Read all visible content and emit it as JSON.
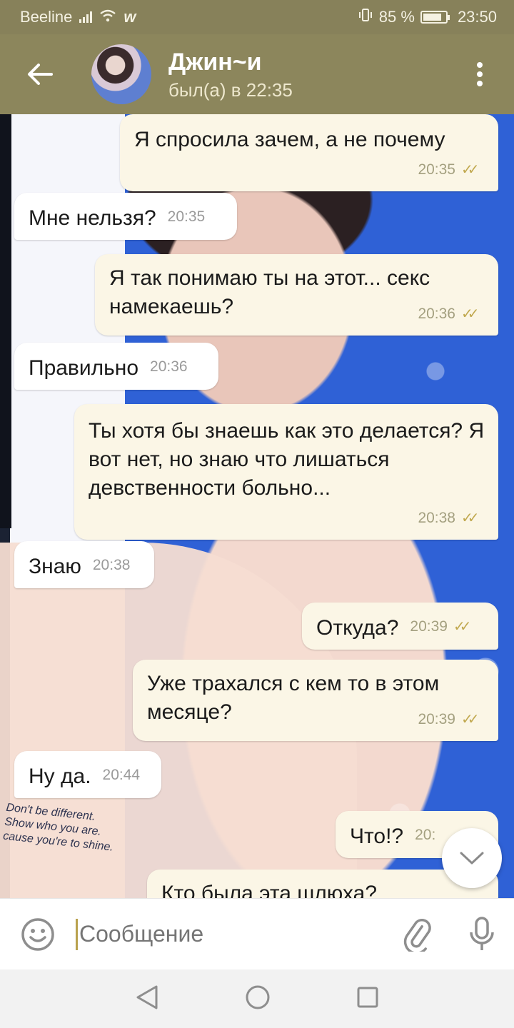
{
  "status_bar": {
    "carrier": "Beeline",
    "battery_percent": "85 %",
    "battery_level": 0.85,
    "time": "23:50"
  },
  "header": {
    "contact_name": "Джин~и",
    "last_seen": "был(а) в 22:35"
  },
  "messages": [
    {
      "direction": "out",
      "text": "Я спросила зачем, а не почему",
      "time": "20:35"
    },
    {
      "direction": "in",
      "text": "Мне нельзя?",
      "time": "20:35"
    },
    {
      "direction": "out",
      "text": "Я так понимаю ты на этот... секс намекаешь?",
      "time": "20:36"
    },
    {
      "direction": "in",
      "text": "Правильно",
      "time": "20:36"
    },
    {
      "direction": "out",
      "text": "Ты хотя бы знаешь как это делается? Я вот нет, но знаю что лишаться девственности больно...",
      "time": "20:38"
    },
    {
      "direction": "in",
      "text": "Знаю",
      "time": "20:38"
    },
    {
      "direction": "out",
      "text": "Откуда?",
      "time": "20:39"
    },
    {
      "direction": "out",
      "text": "Уже трахался с кем то в этом месяце?",
      "time": "20:39"
    },
    {
      "direction": "in",
      "text": "Ну да.",
      "time": "20:44"
    },
    {
      "direction": "out",
      "text": "Что!?",
      "time": "20:"
    },
    {
      "direction": "out",
      "text": "Кто была эта шлюха?",
      "time": ""
    }
  ],
  "wallpaper_print": "Don't be different. Show who you are. cause you're to shine.",
  "input": {
    "placeholder": "Сообщение"
  },
  "colors": {
    "header_bg": "#8c865c",
    "outgoing_bubble": "#fbf6e6",
    "incoming_bubble": "#ffffff",
    "read_ticks": "#c1a950"
  }
}
